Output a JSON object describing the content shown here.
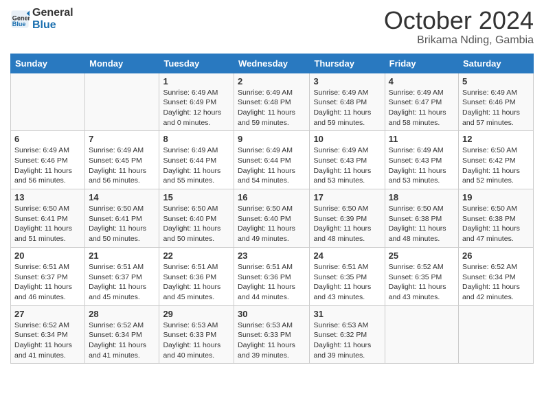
{
  "header": {
    "logo_line1": "General",
    "logo_line2": "Blue",
    "month_year": "October 2024",
    "location": "Brikama Nding, Gambia"
  },
  "weekdays": [
    "Sunday",
    "Monday",
    "Tuesday",
    "Wednesday",
    "Thursday",
    "Friday",
    "Saturday"
  ],
  "weeks": [
    [
      {
        "day": "",
        "detail": ""
      },
      {
        "day": "",
        "detail": ""
      },
      {
        "day": "1",
        "detail": "Sunrise: 6:49 AM\nSunset: 6:49 PM\nDaylight: 12 hours and 0 minutes."
      },
      {
        "day": "2",
        "detail": "Sunrise: 6:49 AM\nSunset: 6:48 PM\nDaylight: 11 hours and 59 minutes."
      },
      {
        "day": "3",
        "detail": "Sunrise: 6:49 AM\nSunset: 6:48 PM\nDaylight: 11 hours and 59 minutes."
      },
      {
        "day": "4",
        "detail": "Sunrise: 6:49 AM\nSunset: 6:47 PM\nDaylight: 11 hours and 58 minutes."
      },
      {
        "day": "5",
        "detail": "Sunrise: 6:49 AM\nSunset: 6:46 PM\nDaylight: 11 hours and 57 minutes."
      }
    ],
    [
      {
        "day": "6",
        "detail": "Sunrise: 6:49 AM\nSunset: 6:46 PM\nDaylight: 11 hours and 56 minutes."
      },
      {
        "day": "7",
        "detail": "Sunrise: 6:49 AM\nSunset: 6:45 PM\nDaylight: 11 hours and 56 minutes."
      },
      {
        "day": "8",
        "detail": "Sunrise: 6:49 AM\nSunset: 6:44 PM\nDaylight: 11 hours and 55 minutes."
      },
      {
        "day": "9",
        "detail": "Sunrise: 6:49 AM\nSunset: 6:44 PM\nDaylight: 11 hours and 54 minutes."
      },
      {
        "day": "10",
        "detail": "Sunrise: 6:49 AM\nSunset: 6:43 PM\nDaylight: 11 hours and 53 minutes."
      },
      {
        "day": "11",
        "detail": "Sunrise: 6:49 AM\nSunset: 6:43 PM\nDaylight: 11 hours and 53 minutes."
      },
      {
        "day": "12",
        "detail": "Sunrise: 6:50 AM\nSunset: 6:42 PM\nDaylight: 11 hours and 52 minutes."
      }
    ],
    [
      {
        "day": "13",
        "detail": "Sunrise: 6:50 AM\nSunset: 6:41 PM\nDaylight: 11 hours and 51 minutes."
      },
      {
        "day": "14",
        "detail": "Sunrise: 6:50 AM\nSunset: 6:41 PM\nDaylight: 11 hours and 50 minutes."
      },
      {
        "day": "15",
        "detail": "Sunrise: 6:50 AM\nSunset: 6:40 PM\nDaylight: 11 hours and 50 minutes."
      },
      {
        "day": "16",
        "detail": "Sunrise: 6:50 AM\nSunset: 6:40 PM\nDaylight: 11 hours and 49 minutes."
      },
      {
        "day": "17",
        "detail": "Sunrise: 6:50 AM\nSunset: 6:39 PM\nDaylight: 11 hours and 48 minutes."
      },
      {
        "day": "18",
        "detail": "Sunrise: 6:50 AM\nSunset: 6:38 PM\nDaylight: 11 hours and 48 minutes."
      },
      {
        "day": "19",
        "detail": "Sunrise: 6:50 AM\nSunset: 6:38 PM\nDaylight: 11 hours and 47 minutes."
      }
    ],
    [
      {
        "day": "20",
        "detail": "Sunrise: 6:51 AM\nSunset: 6:37 PM\nDaylight: 11 hours and 46 minutes."
      },
      {
        "day": "21",
        "detail": "Sunrise: 6:51 AM\nSunset: 6:37 PM\nDaylight: 11 hours and 45 minutes."
      },
      {
        "day": "22",
        "detail": "Sunrise: 6:51 AM\nSunset: 6:36 PM\nDaylight: 11 hours and 45 minutes."
      },
      {
        "day": "23",
        "detail": "Sunrise: 6:51 AM\nSunset: 6:36 PM\nDaylight: 11 hours and 44 minutes."
      },
      {
        "day": "24",
        "detail": "Sunrise: 6:51 AM\nSunset: 6:35 PM\nDaylight: 11 hours and 43 minutes."
      },
      {
        "day": "25",
        "detail": "Sunrise: 6:52 AM\nSunset: 6:35 PM\nDaylight: 11 hours and 43 minutes."
      },
      {
        "day": "26",
        "detail": "Sunrise: 6:52 AM\nSunset: 6:34 PM\nDaylight: 11 hours and 42 minutes."
      }
    ],
    [
      {
        "day": "27",
        "detail": "Sunrise: 6:52 AM\nSunset: 6:34 PM\nDaylight: 11 hours and 41 minutes."
      },
      {
        "day": "28",
        "detail": "Sunrise: 6:52 AM\nSunset: 6:34 PM\nDaylight: 11 hours and 41 minutes."
      },
      {
        "day": "29",
        "detail": "Sunrise: 6:53 AM\nSunset: 6:33 PM\nDaylight: 11 hours and 40 minutes."
      },
      {
        "day": "30",
        "detail": "Sunrise: 6:53 AM\nSunset: 6:33 PM\nDaylight: 11 hours and 39 minutes."
      },
      {
        "day": "31",
        "detail": "Sunrise: 6:53 AM\nSunset: 6:32 PM\nDaylight: 11 hours and 39 minutes."
      },
      {
        "day": "",
        "detail": ""
      },
      {
        "day": "",
        "detail": ""
      }
    ]
  ]
}
